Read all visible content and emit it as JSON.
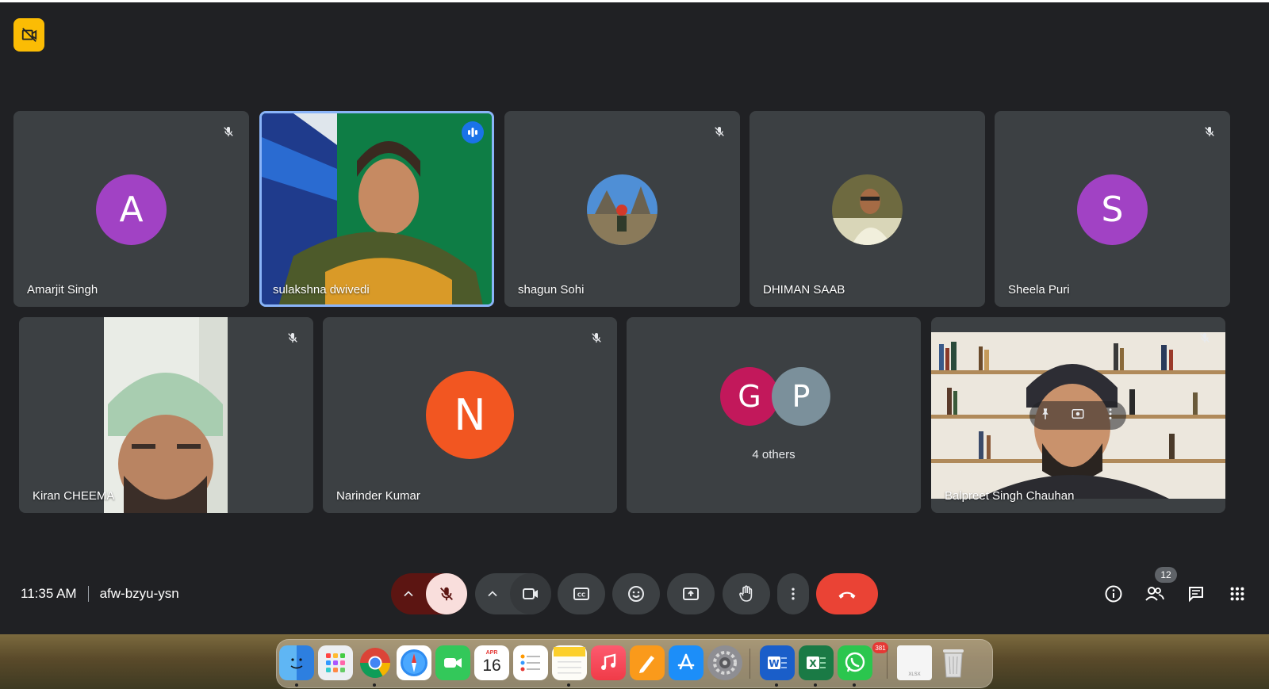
{
  "meeting": {
    "time": "11:35 AM",
    "code": "afw-bzyu-ysn",
    "people_count": "12"
  },
  "participants": [
    {
      "name": "Amarjit Singh",
      "avatar_letter": "A",
      "avatar_color": "#a142c4",
      "muted": true
    },
    {
      "name": "sulakshna dwivedi",
      "video": true,
      "speaking": true
    },
    {
      "name": "shagun Sohi",
      "photo_avatar": true,
      "muted": true
    },
    {
      "name": "DHIMAN SAAB",
      "photo_avatar": true
    },
    {
      "name": "Sheela Puri",
      "avatar_letter": "S",
      "avatar_color": "#a142c4",
      "muted": true
    },
    {
      "name": "Kiran CHEEMA",
      "video": true,
      "muted": true
    },
    {
      "name": "Narinder Kumar",
      "avatar_letter": "N",
      "avatar_color": "#f25621",
      "muted": true
    },
    {
      "name": "Balpreet Singh Chauhan",
      "video": true,
      "muted": true
    }
  ],
  "others_group": {
    "label": "4 others",
    "avatars": [
      {
        "letter": "G",
        "color": "#c2185b"
      },
      {
        "letter": "P",
        "color": "#7b909b"
      }
    ]
  },
  "controls": {
    "end_call_color": "#ea4335",
    "mic_muted_bg": "#f9dedc"
  },
  "dock": {
    "calendar_month": "APR",
    "calendar_day": "16",
    "whatsapp_badge": "381",
    "file_label": "XLSX",
    "apps": [
      "finder-icon",
      "launchpad-icon",
      "chrome-icon",
      "safari-icon",
      "facetime-icon",
      "calendar-icon",
      "reminders-icon",
      "notes-icon",
      "music-icon",
      "pages-icon",
      "app-store-icon",
      "system-settings-icon",
      "word-icon",
      "excel-icon",
      "whatsapp-icon",
      "xlsx-file-icon",
      "trash-icon"
    ]
  }
}
